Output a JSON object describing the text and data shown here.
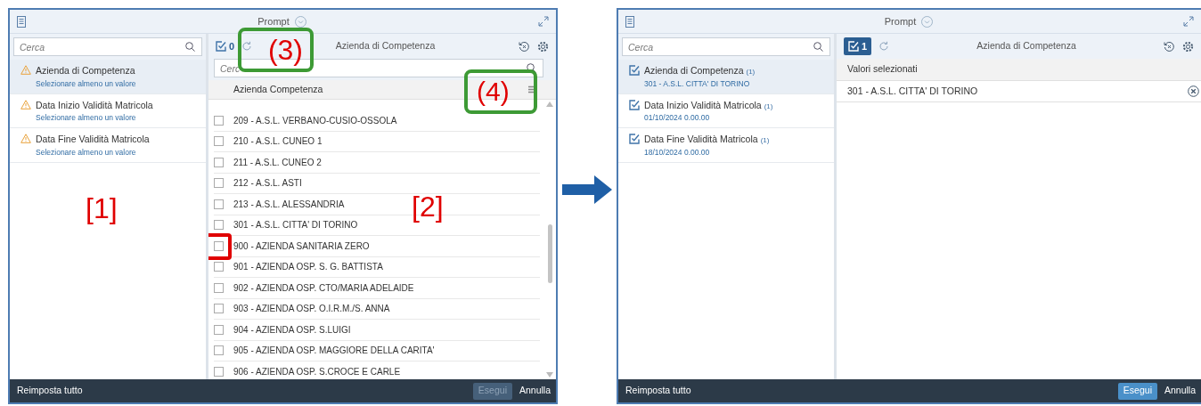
{
  "dialogs": [
    {
      "title": "Prompt",
      "left_pane": {
        "search": {
          "placeholder": "Cerca"
        },
        "annotation": "[1]",
        "items": [
          {
            "kind": "warning",
            "title": "Azienda di Competenza",
            "subtitle": "Selezionare almeno un valore",
            "selected": true
          },
          {
            "kind": "warning",
            "title": "Data Inizio Validità Matricola",
            "subtitle": "Selezionare almeno un valore",
            "selected": false
          },
          {
            "kind": "warning",
            "title": "Data Fine Validità Matricola",
            "subtitle": "Selezionare almeno un valore",
            "selected": false
          }
        ]
      },
      "right_pane": {
        "kind": "list",
        "selected_count": "0",
        "selected_count_active": false,
        "toolbar_annotation": "(3)",
        "title": "Azienda di Competenza",
        "search": {
          "placeholder": "Cerc"
        },
        "column_header": "Azienda Competenza",
        "header_annotation": "(4)",
        "annotation": "[2]",
        "rows": [
          {
            "label": "209 - A.S.L. VERBANO-CUSIO-OSSOLA",
            "checked": false,
            "highlighted": false
          },
          {
            "label": "210 - A.S.L. CUNEO 1",
            "checked": false,
            "highlighted": false
          },
          {
            "label": "211 - A.S.L. CUNEO 2",
            "checked": false,
            "highlighted": false
          },
          {
            "label": "212 - A.S.L. ASTI",
            "checked": false,
            "highlighted": false
          },
          {
            "label": "213 - A.S.L. ALESSANDRIA",
            "checked": false,
            "highlighted": false
          },
          {
            "label": "301 - A.S.L. CITTA' DI TORINO",
            "checked": false,
            "highlighted": false
          },
          {
            "label": "900 - AZIENDA SANITARIA ZERO",
            "checked": false,
            "highlighted": true
          },
          {
            "label": "901 - AZIENDA OSP. S. G. BATTISTA",
            "checked": false,
            "highlighted": false
          },
          {
            "label": "902 - AZIENDA OSP. CTO/MARIA ADELAIDE",
            "checked": false,
            "highlighted": false
          },
          {
            "label": "903 - AZIENDA OSP. O.I.R.M./S. ANNA",
            "checked": false,
            "highlighted": false
          },
          {
            "label": "904 - AZIENDA OSP. S.LUIGI",
            "checked": false,
            "highlighted": false
          },
          {
            "label": "905 - AZIENDA OSP. MAGGIORE DELLA CARITA'",
            "checked": false,
            "highlighted": false
          },
          {
            "label": "906 - AZIENDA OSP. S.CROCE E CARLE",
            "checked": false,
            "highlighted": false
          }
        ]
      },
      "footer": {
        "reset": "Reimposta tutto",
        "run": {
          "label": "Esegui",
          "disabled": true
        },
        "cancel": "Annulla"
      }
    },
    {
      "title": "Prompt",
      "left_pane": {
        "search": {
          "placeholder": "Cerca"
        },
        "items": [
          {
            "kind": "done",
            "title": "Azienda di Competenza",
            "count": "(1)",
            "subtitle": "301 - A.S.L. CITTA' DI TORINO",
            "selected": true
          },
          {
            "kind": "done",
            "title": "Data Inizio Validità Matricola",
            "count": "(1)",
            "subtitle": "01/10/2024 0.00.00",
            "selected": false
          },
          {
            "kind": "done",
            "title": "Data Fine Validità Matricola",
            "count": "(1)",
            "subtitle": "18/10/2024 0.00.00",
            "selected": false
          }
        ]
      },
      "right_pane": {
        "kind": "selected",
        "selected_count": "1",
        "selected_count_active": true,
        "title": "Azienda di Competenza",
        "selected_header": "Valori selezionati",
        "values": [
          "301 - A.S.L. CITTA' DI TORINO"
        ]
      },
      "footer": {
        "reset": "Reimposta tutto",
        "run": {
          "label": "Esegui",
          "disabled": false
        },
        "cancel": "Annulla"
      }
    }
  ]
}
